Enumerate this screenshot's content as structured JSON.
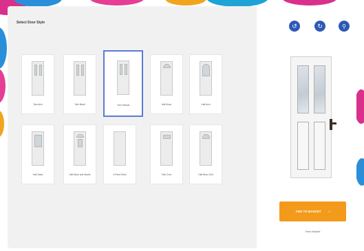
{
  "panel_title": "Select Door Style",
  "door_styles": [
    {
      "label": "Twin Arch"
    },
    {
      "label": "Twin Bevel"
    },
    {
      "label": "Twin Vertical"
    },
    {
      "label": "Half Moon"
    },
    {
      "label": "Half Arch"
    },
    {
      "label": "Half Glass"
    },
    {
      "label": "Half Moon and Muntin"
    },
    {
      "label": "4 Panel Solid"
    },
    {
      "label": "Twin Cove"
    },
    {
      "label": "Half Moon Grid"
    }
  ],
  "selected_style": "Twin Vertical",
  "toolbar": {
    "rotate_left_icon": "rotate-left-icon",
    "rotate_right_icon": "rotate-right-icon",
    "zoom_icon": "zoom-icon"
  },
  "colors": {
    "accent": "#2e58b6",
    "cta": "#f39a1b",
    "selected_border": "#5a7bd4"
  },
  "cta": {
    "label": "ADD TO BASKET",
    "arrow": "›"
  },
  "view_link": "View Basket"
}
